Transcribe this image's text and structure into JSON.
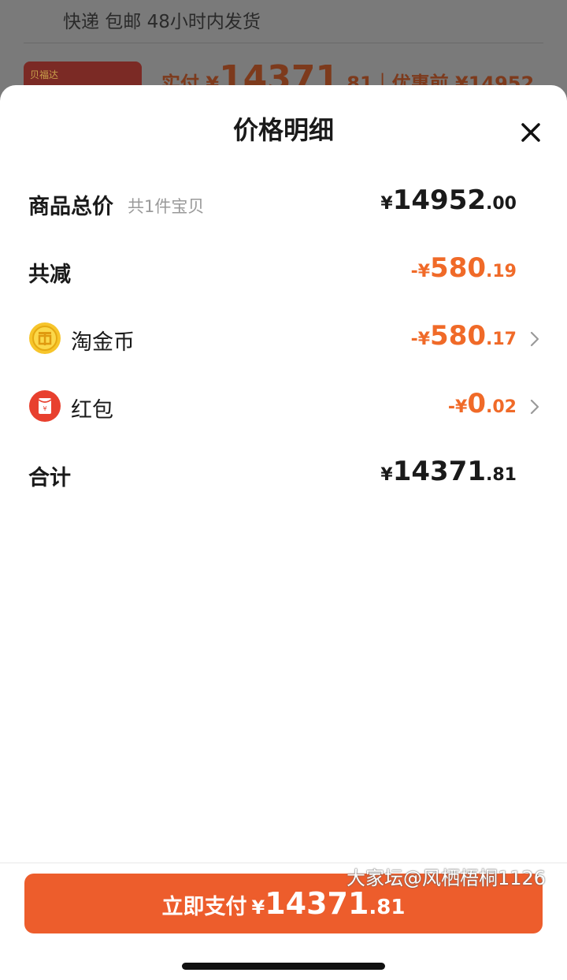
{
  "background": {
    "shipping_line": "快递 包邮 48小时内发货",
    "thumb_label": "贝福达",
    "price_prefix": "实付 ¥",
    "price_int": "14371",
    "price_dec": ".81",
    "price_orig": "｜优惠前 ¥14952"
  },
  "sheet": {
    "title": "价格明细",
    "close_icon": "close-icon"
  },
  "rows": {
    "total": {
      "label": "商品总价",
      "sub": "共1件宝贝",
      "currency": "¥",
      "int": "14952",
      "dec": ".00"
    },
    "discount": {
      "label": "共减",
      "currency": "-¥",
      "int": "580",
      "dec": ".19"
    },
    "coins": {
      "icon": "gold-coin-icon",
      "label": "淘金币",
      "currency": "-¥",
      "int": "580",
      "dec": ".17"
    },
    "redpacket": {
      "icon": "red-packet-icon",
      "label": "红包",
      "currency": "-¥",
      "int": "0",
      "dec": ".02"
    },
    "sum": {
      "label": "合计",
      "currency": "¥",
      "int": "14371",
      "dec": ".81"
    }
  },
  "pay_button": {
    "label": "立即支付",
    "currency": "¥",
    "int": "14371",
    "dec": ".81"
  },
  "watermark": "大家坛@风栖梧桐1126",
  "colors": {
    "accent": "#ed5d2c",
    "discount": "#f06a28",
    "text": "#1a1a1a"
  }
}
